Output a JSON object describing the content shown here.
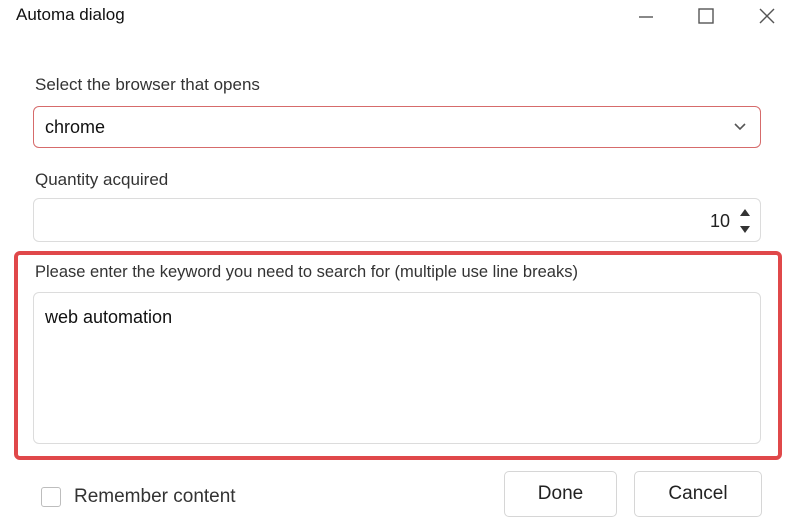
{
  "window": {
    "title": "Automa dialog",
    "controls": [
      "minimize-icon",
      "maximize-icon",
      "close-icon"
    ]
  },
  "browser_select": {
    "label": "Select the browser that opens",
    "value": "chrome",
    "icon": "chevron-down-icon"
  },
  "quantity": {
    "label": "Quantity acquired",
    "value": "10",
    "icon": "spinner-arrows-icon"
  },
  "keywords": {
    "label": "Please enter the keyword you need to search for (multiple use line breaks)",
    "value": "web automation"
  },
  "footer": {
    "remember_label": "Remember content",
    "remember_checked": false,
    "done_label": "Done",
    "cancel_label": "Cancel"
  },
  "colors": {
    "highlight_border": "#e0484a",
    "select_border": "#d66b6b"
  }
}
